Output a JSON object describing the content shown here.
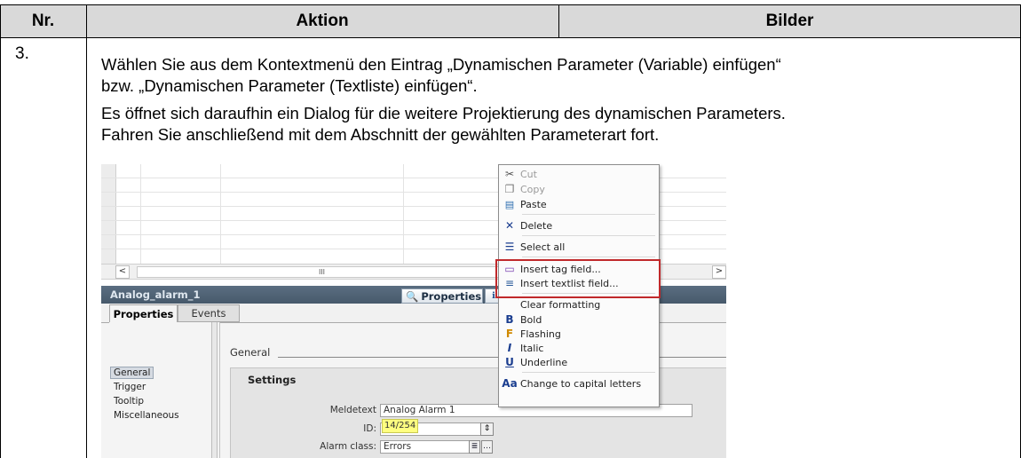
{
  "table": {
    "headers": [
      "Nr.",
      "Aktion",
      "Bilder"
    ],
    "row_number": "3.",
    "paragraphs": [
      "Wählen Sie aus dem Kontextmenü den Eintrag „Dynamischen Parameter (Variable) einfügen“",
      "bzw. „Dynamischen Parameter (Textliste) einfügen“.",
      "Es öffnet sich daraufhin ein Dialog für die weitere Projektierung des dynamischen Parameters.",
      "Fahren Sie anschließend mit dem Abschnitt der gewählten Parameterart fort."
    ]
  },
  "screenshot": {
    "scroll_thumb": "III",
    "scroll_left": "<",
    "scroll_right": ">",
    "window_title": "Analog_alarm_1",
    "properties_button": "Properties",
    "tabs": [
      "Properties",
      "Events"
    ],
    "section_title": "General",
    "nav_items": [
      "General",
      "Trigger",
      "Tooltip",
      "Miscellaneous"
    ],
    "settings_label": "Settings",
    "fields": {
      "meldetext_label": "Meldetext",
      "meldetext_value": "Analog Alarm 1",
      "id_label": "ID:",
      "id_tooltip": "14/254",
      "alarm_class_label": "Alarm class:",
      "alarm_class_value": "Errors"
    },
    "context_menu": {
      "items": [
        {
          "label": "Cut",
          "icon": "cut-icon",
          "glyph": "✂",
          "disabled": true
        },
        {
          "label": "Copy",
          "icon": "copy-icon",
          "glyph": "❐",
          "disabled": true
        },
        {
          "label": "Paste",
          "icon": "paste-icon",
          "glyph": "📋",
          "disabled": false
        },
        {
          "label": "Delete",
          "icon": "delete-icon",
          "glyph": "✕",
          "disabled": false
        },
        {
          "label": "Select all",
          "icon": "select-all-icon",
          "glyph": "☰",
          "disabled": false
        },
        {
          "label": "Insert tag field...",
          "icon": "tag-field-icon",
          "glyph": "▭",
          "disabled": false
        },
        {
          "label": "Insert textlist field...",
          "icon": "textlist-field-icon",
          "glyph": "≡",
          "disabled": false
        },
        {
          "label": "Clear formatting",
          "icon": "",
          "glyph": "",
          "disabled": false
        },
        {
          "label": "Bold",
          "icon": "bold-icon",
          "glyph": "B",
          "disabled": false
        },
        {
          "label": "Flashing",
          "icon": "flashing-icon",
          "glyph": "F",
          "disabled": false
        },
        {
          "label": "Italic",
          "icon": "italic-icon",
          "glyph": "I",
          "disabled": false
        },
        {
          "label": "Underline",
          "icon": "underline-icon",
          "glyph": "U",
          "disabled": false
        },
        {
          "label": "Change to capital letters",
          "icon": "capital-letters-icon",
          "glyph": "Aa",
          "disabled": false
        }
      ]
    }
  }
}
